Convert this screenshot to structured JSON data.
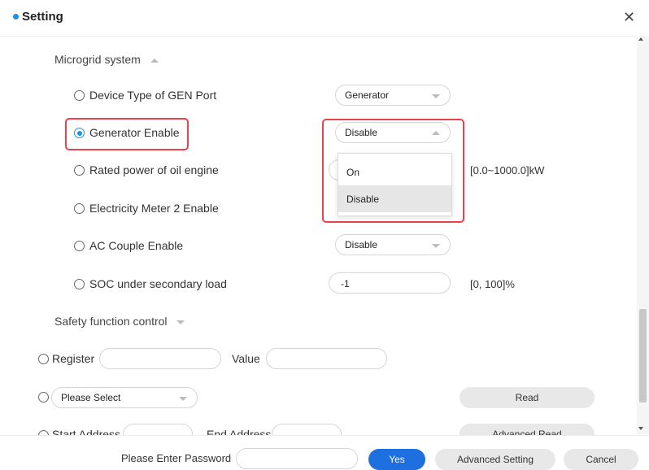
{
  "dialog": {
    "title": "Setting"
  },
  "sections": {
    "microgrid": "Microgrid system",
    "safety": "Safety function control"
  },
  "rows": {
    "device_type": {
      "label": "Device Type of GEN Port",
      "value": "Generator"
    },
    "generator_enable": {
      "label": "Generator Enable",
      "value": "Disable"
    },
    "rated_power": {
      "label": "Rated power of oil engine",
      "unit": "[0.0~1000.0]kW"
    },
    "meter2": {
      "label": "Electricity Meter 2 Enable"
    },
    "ac_couple": {
      "label": "AC Couple Enable",
      "value": "Disable"
    },
    "soc": {
      "label": "SOC under secondary load",
      "value": "-1",
      "unit": "[0, 100]%"
    }
  },
  "dropdown": {
    "options": [
      "On",
      "Disable"
    ],
    "selected": "Disable"
  },
  "register": {
    "register_label": "Register",
    "value_label": "Value",
    "select_placeholder": "Please Select",
    "read_label": "Read",
    "start_label": "Start Address",
    "end_label": "End Address",
    "advanced_read_label": "Advanced Read"
  },
  "footer": {
    "password_label": "Please Enter Password",
    "yes": "Yes",
    "advanced_setting": "Advanced Setting",
    "cancel": "Cancel"
  },
  "colors": {
    "accent": "#1e6fe0",
    "highlight_box": "#e8434b"
  },
  "icons": {
    "close": "close-icon",
    "caret": "chevron-down-icon"
  }
}
